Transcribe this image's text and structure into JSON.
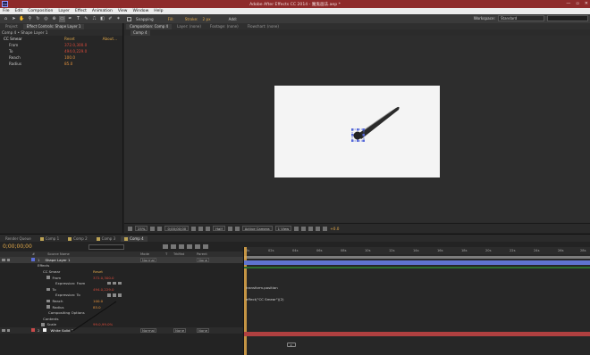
{
  "app": {
    "title": "Adobe After Effects CC 2014 - 魔鬼画法.aep *",
    "icon_label": "Ae",
    "window_buttons": [
      "—",
      "▫",
      "✕"
    ]
  },
  "menu": [
    "File",
    "Edit",
    "Composition",
    "Layer",
    "Effect",
    "Animation",
    "View",
    "Window",
    "Help"
  ],
  "toolbar": {
    "snapping_label": "Snapping",
    "fill_label": "Fill:",
    "stroke_label": "Stroke:",
    "stroke_size": "2 px",
    "add_label": "Add:",
    "workspace_label": "Workspace:",
    "workspace_value": "Standard"
  },
  "left_panel": {
    "tabs": [
      "Project",
      "Effect Controls: Shape Layer 1"
    ],
    "header": "Comp 4 • Shape Layer 1",
    "rows": [
      {
        "name": "CC Smear",
        "value": "Reset",
        "extra": "About..."
      },
      {
        "name": "From",
        "value": "372.0,300.0"
      },
      {
        "name": "To",
        "value": "494.0,229.0"
      },
      {
        "name": "Reach",
        "value": "100.0"
      },
      {
        "name": "Radius",
        "value": "85.0"
      }
    ]
  },
  "comp_panel": {
    "tabs": [
      "Composition: Comp 4",
      "Layer: (none)",
      "Footage: (none)",
      "Flowchart: (none)"
    ],
    "subtab": "Comp 4",
    "viewer_bar": {
      "zoom": "25%",
      "time": "0;00;00;00",
      "resolution": "Half",
      "camera": "Active Camera",
      "views": "1 View",
      "exposure": "+0.0"
    }
  },
  "timeline": {
    "tabs": [
      "Render Queue",
      "Comp 1",
      "Comp 2",
      "Comp 3",
      "Comp 4"
    ],
    "timecode": "0;00;00;00",
    "columns": [
      "#",
      "Source Name",
      "Mode",
      "T",
      "TrkMat",
      "Parent"
    ],
    "ruler": [
      "0s",
      "02s",
      "04s",
      "06s",
      "08s",
      "10s",
      "12s",
      "14s",
      "16s",
      "18s",
      "20s",
      "22s",
      "24s",
      "26s",
      "28s"
    ],
    "rows": [
      {
        "kind": "layer",
        "num": "1",
        "name": "Shape Layer 1",
        "mode": "Normal",
        "parent": "None",
        "color": "#5c6ed8"
      },
      {
        "kind": "prop",
        "name": "Effects"
      },
      {
        "kind": "prop",
        "name": "CC Smear",
        "value": "Reset"
      },
      {
        "kind": "prop",
        "name": "From",
        "value": "372.0,300.0",
        "value_style": "red"
      },
      {
        "kind": "prop",
        "name": "Expression: From"
      },
      {
        "kind": "prop",
        "name": "To",
        "value": "494.0,229.0",
        "value_style": "red"
      },
      {
        "kind": "prop",
        "name": "Expression: To"
      },
      {
        "kind": "prop",
        "name": "Reach",
        "value": "100.0"
      },
      {
        "kind": "prop",
        "name": "Radius",
        "value": "85.0"
      },
      {
        "kind": "prop",
        "name": "Compositing Options"
      },
      {
        "kind": "prop",
        "name": "Contents"
      },
      {
        "kind": "prop",
        "name": "Scale",
        "value": "99.0,99.0%"
      },
      {
        "kind": "layer",
        "num": "2",
        "name": "White Solid 2",
        "mode": "Normal",
        "trkmat": "None",
        "parent": "None",
        "color": "#c84a4a"
      }
    ],
    "expressions": [
      "transform.position",
      "effect(\"CC Smear\")(2)"
    ]
  }
}
